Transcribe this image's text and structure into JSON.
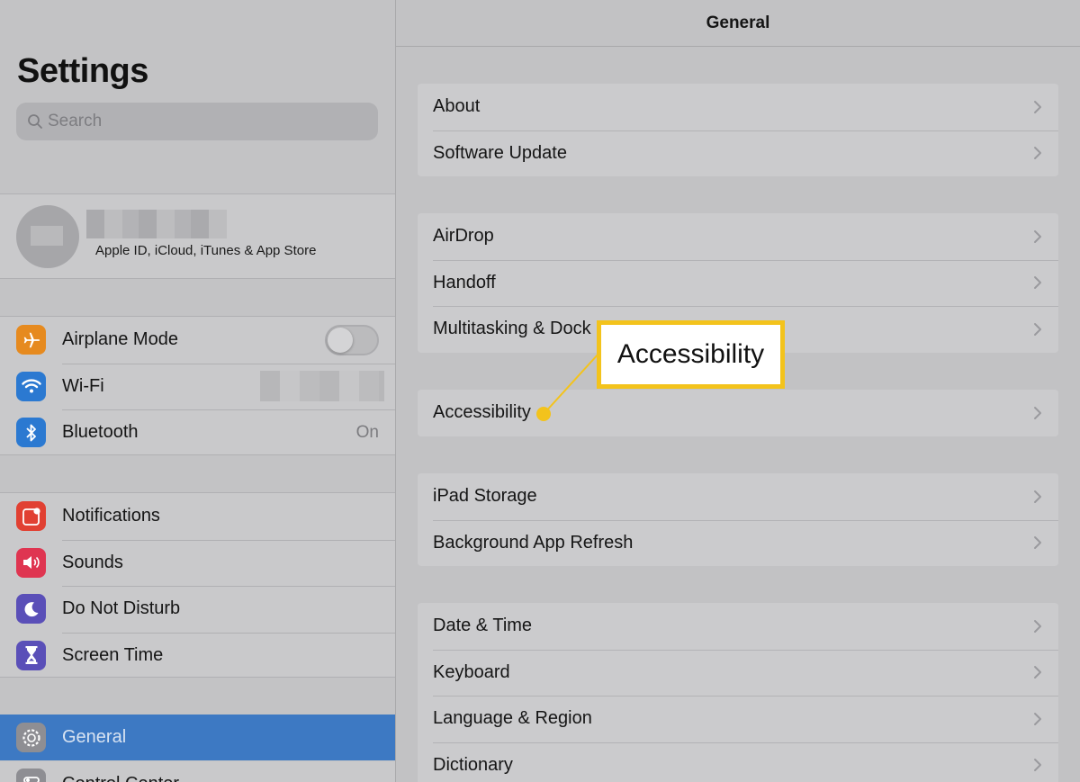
{
  "sidebar": {
    "title": "Settings",
    "search_placeholder": "Search",
    "profile_subtitle": "Apple ID, iCloud, iTunes & App Store",
    "group1": [
      {
        "label": "Airplane Mode",
        "icon": "airplane-icon",
        "color": "#e68a1f"
      },
      {
        "label": "Wi-Fi",
        "icon": "wifi-icon",
        "color": "#2b79d1"
      },
      {
        "label": "Bluetooth",
        "icon": "bluetooth-icon",
        "color": "#2b79d1",
        "value": "On"
      }
    ],
    "group2": [
      {
        "label": "Notifications",
        "icon": "notifications-icon",
        "color": "#e14032"
      },
      {
        "label": "Sounds",
        "icon": "sounds-icon",
        "color": "#df3551"
      },
      {
        "label": "Do Not Disturb",
        "icon": "moon-icon",
        "color": "#5a4fb8"
      },
      {
        "label": "Screen Time",
        "icon": "hourglass-icon",
        "color": "#5a4fb8"
      }
    ],
    "selected": {
      "label": "General",
      "icon": "gear-icon",
      "color": "#3d79c3"
    },
    "next": {
      "label": "Control Center",
      "icon": "control-center-icon"
    }
  },
  "main": {
    "title": "General",
    "groups": [
      [
        "About",
        "Software Update"
      ],
      [
        "AirDrop",
        "Handoff",
        "Multitasking & Dock"
      ],
      [
        "Accessibility"
      ],
      [
        "iPad Storage",
        "Background App Refresh"
      ],
      [
        "Date & Time",
        "Keyboard",
        "Language & Region",
        "Dictionary"
      ]
    ]
  },
  "callout": {
    "text": "Accessibility",
    "color": "#f3c31c"
  }
}
